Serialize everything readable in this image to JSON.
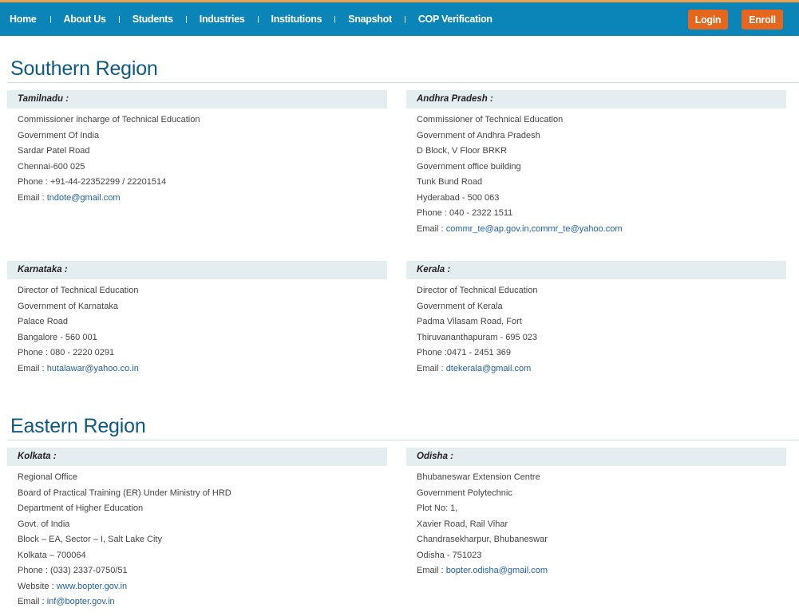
{
  "nav": {
    "items": [
      "Home",
      "About Us",
      "Students",
      "Industries",
      "Institutions",
      "Snapshot",
      "COP Verification"
    ],
    "login_label": "Login",
    "enroll_label": "Enroll"
  },
  "colors": {
    "nav_bg": "#0b84b8",
    "accent_top": "#f0a04b",
    "button_bg": "#e4671d",
    "heading": "#0e5a86",
    "card_head_bg": "#e4edf0",
    "link": "#1f62a8"
  },
  "regions": [
    {
      "title": "Southern Region",
      "cards": [
        {
          "state": "Tamilnadu :",
          "lines": [
            "Commissioner incharge of Technical Education",
            "Government Of India",
            "Sardar Patel Road",
            "Chennai-600 025",
            "Phone : +91-44-22352299 / 22201514"
          ],
          "email_label": "Email : ",
          "email": "tndote@gmail.com"
        },
        {
          "state": "Andhra Pradesh :",
          "lines": [
            "Commissioner of Technical Education",
            "Government of Andhra Pradesh",
            "D Block, V Floor BRKR",
            "Government office building",
            "Tunk Bund Road",
            "Hyderabad - 500 063",
            "Phone : 040 - 2322 1511"
          ],
          "email_label": "Email : ",
          "email": "commr_te@ap.gov.in,commr_te@yahoo.com"
        },
        {
          "state": "Karnataka :",
          "lines": [
            "Director of Technical Education",
            "Government of Karnataka",
            "Palace Road",
            "Bangalore - 560 001",
            "Phone : 080 - 2220 0291"
          ],
          "email_label": "Email : ",
          "email": "hutalawar@yahoo.co.in"
        },
        {
          "state": "Kerala :",
          "lines": [
            "Director of Technical Education",
            "Government of Kerala",
            "Padma Vilasam Road, Fort",
            "Thiruvananthapuram - 695 023",
            "Phone :0471 - 2451 369"
          ],
          "email_label": "Email : ",
          "email": "dtekerala@gmail.com"
        }
      ]
    },
    {
      "title": "Eastern Region",
      "cards": [
        {
          "state": "Kolkata :",
          "lines": [
            "Regional Office",
            "Board of Practical Training (ER) Under Ministry of HRD",
            "Department of Higher Education",
            "Govt. of India",
            "Block – EA, Sector – I, Salt Lake City",
            "Kolkata – 700064",
            "Phone : (033) 2337-0750/51"
          ],
          "website_label": "Website : ",
          "website": "www.bopter.gov.in",
          "email_label": "Email : ",
          "email": "inf@bopter.gov.in"
        },
        {
          "state": "Odisha :",
          "lines": [
            "Bhubaneswar Extension Centre",
            "Government Polytechnic",
            "Plot No: 1,",
            "Xavier Road, Rail Vihar",
            "Chandrasekharpur, Bhubaneswar",
            "Odisha - 751023"
          ],
          "email_label": "Email : ",
          "email": "bopter.odisha@gmail.com"
        }
      ]
    }
  ]
}
